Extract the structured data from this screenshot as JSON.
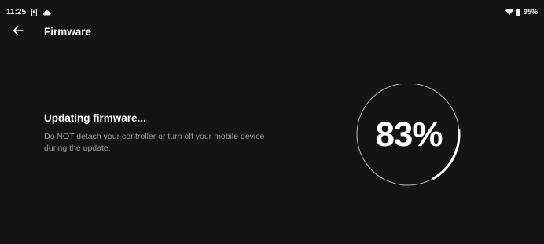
{
  "status_bar": {
    "time": "11:25",
    "battery_text": "95%",
    "icons": [
      "phone-notification-icon",
      "cloud-icon",
      "wifi-icon",
      "battery-icon"
    ]
  },
  "app_bar": {
    "title": "Firmware",
    "back_icon": "arrow-back-icon"
  },
  "update": {
    "title": "Updating firmware...",
    "description_line1": "Do NOT detach your controller or turn off your mobile device",
    "description_line2": "during the update."
  },
  "progress": {
    "percent_text": "83%",
    "value": 0.83
  },
  "colors": {
    "background": "#141414",
    "text_primary": "#ffffff",
    "text_secondary": "#9a9a9a",
    "ring_track": "#bdbdbd",
    "ring_fill": "#ffffff"
  }
}
